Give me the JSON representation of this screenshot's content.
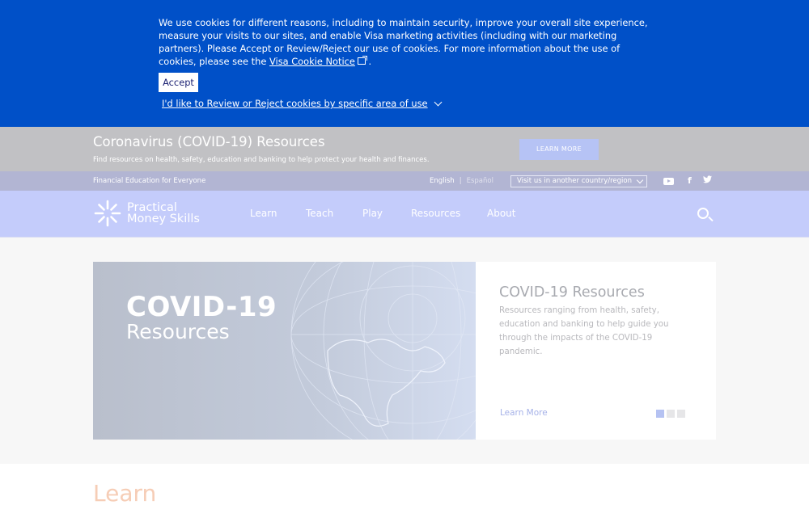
{
  "cookie": {
    "text_before_link": "We use cookies for different reasons, including to maintain security, improve your overall site experience, measure your visits to our sites, and enable Visa marketing activities (including with our marketing partners). Please Accept or Review/Reject our use of cookies. For more information about the use of cookies, please see the ",
    "notice_link": "Visa Cookie Notice",
    "after_link": ".",
    "accept_label": "Accept",
    "review_link": "I'd like to Review or Reject cookies by specific area of use"
  },
  "covid_bar": {
    "title": "Coronavirus (COVID-19) Resources",
    "subtitle": "Find resources on health, safety, education and banking to help protect your health and finances.",
    "button": "LEARN MORE"
  },
  "utility": {
    "tagline": "Financial Education for Everyone",
    "lang_en": "English",
    "lang_sep": "|",
    "lang_es": "Español",
    "country_select": "Visit us in another country/region"
  },
  "social": {
    "facebook": "f",
    "twitter": "🐦"
  },
  "logo": {
    "line1": "Practical",
    "line2": "Money Skills"
  },
  "nav": {
    "items": [
      "Learn",
      "Teach",
      "Play",
      "Resources",
      "About"
    ]
  },
  "hero": {
    "title": "COVID-19",
    "subtitle": "Resources",
    "card_title": "COVID-19 Resources",
    "card_body": "Resources ranging from health, safety, education and banking to help guide you through the impacts of the COVID-19 pandemic.",
    "card_link": "Learn More"
  },
  "learn": {
    "heading": "Learn"
  },
  "colors": {
    "cookie_bg": "#0050c8",
    "nav_bg": "#c4ccfb",
    "utility_bg": "#b2b5d3",
    "covid_bg": "#c1c1c4",
    "learn_heading": "#f6cdb6"
  }
}
